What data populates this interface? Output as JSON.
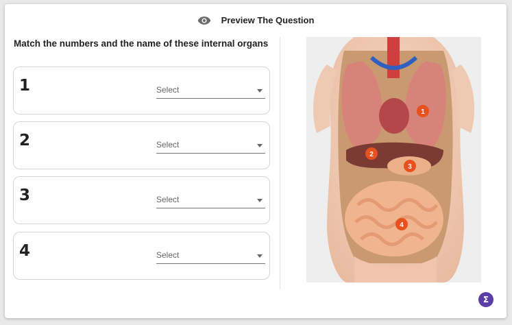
{
  "header": {
    "title": "Preview The Question",
    "icon": "eye-icon"
  },
  "question": {
    "text": "Match the numbers and the name of these internal organs"
  },
  "rows": [
    {
      "number": "1",
      "placeholder": "Select"
    },
    {
      "number": "2",
      "placeholder": "Select"
    },
    {
      "number": "3",
      "placeholder": "Select"
    },
    {
      "number": "4",
      "placeholder": "Select"
    }
  ],
  "image": {
    "markers": [
      {
        "label": "1"
      },
      {
        "label": "2"
      },
      {
        "label": "3"
      },
      {
        "label": "4"
      }
    ],
    "marker_color": "#e8501e"
  },
  "fab": {
    "label": "Σ",
    "color": "#5b3ea8"
  }
}
